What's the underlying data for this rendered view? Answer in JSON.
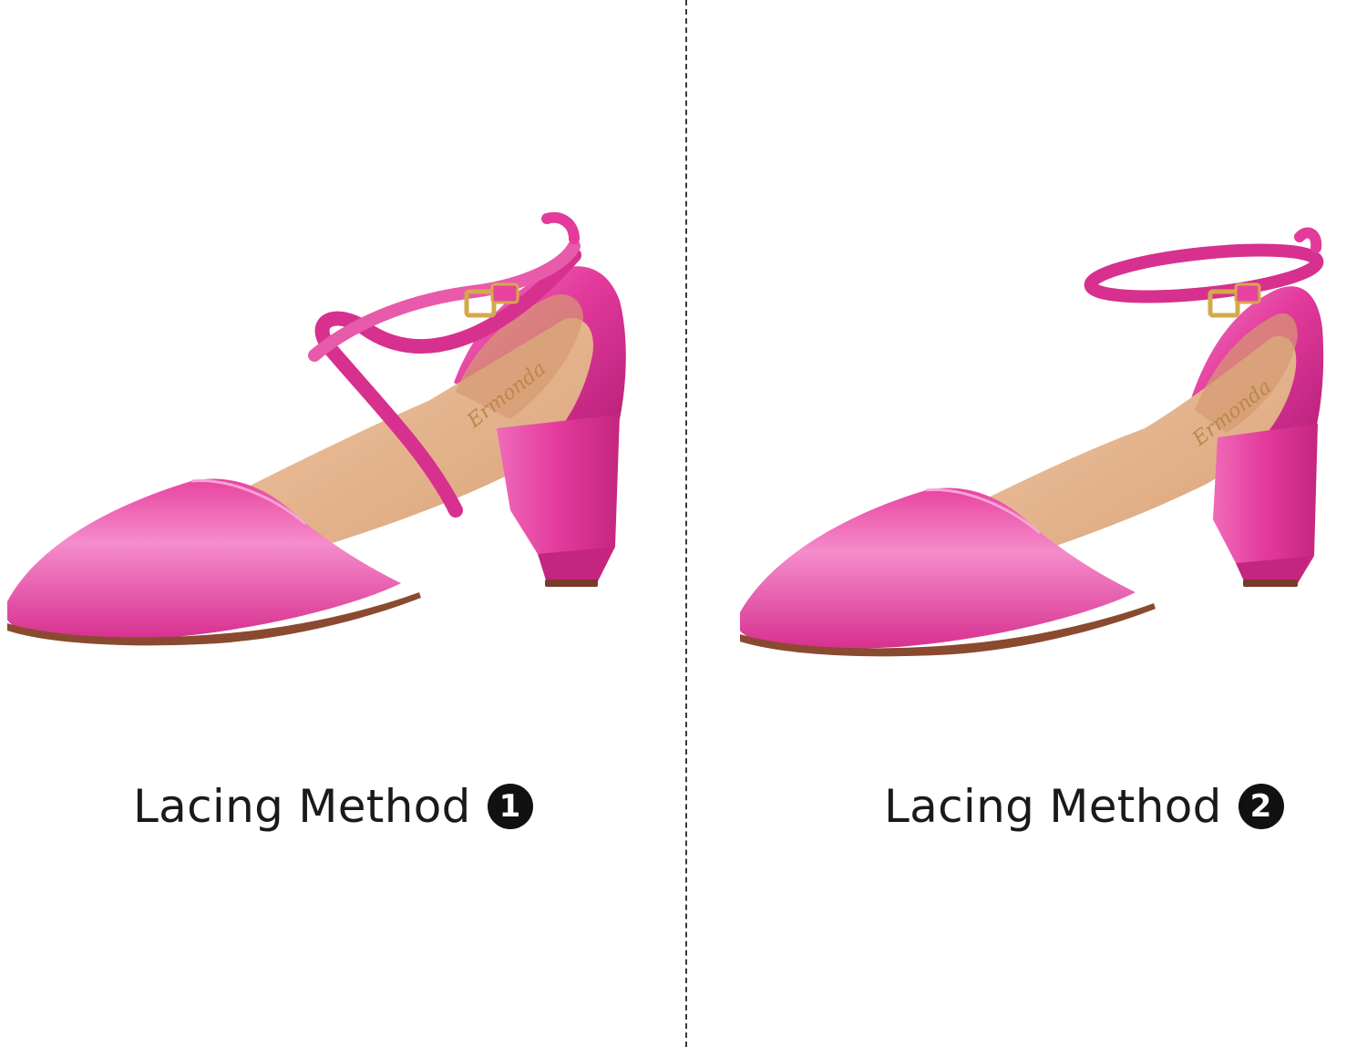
{
  "colors": {
    "satin": "#e33a9c",
    "satin_light": "#f27ac1",
    "satin_dark": "#b8217a",
    "insole": "#e8b690",
    "insole_dark": "#c98c62",
    "buckle": "#d4a94a",
    "badge_bg": "#111111",
    "badge_text": "#ffffff"
  },
  "panels": [
    {
      "caption": "Lacing Method",
      "number": "1",
      "image_label": "pink satin pointed-toe block heel with crisscross ankle strap"
    },
    {
      "caption": "Lacing Method",
      "number": "2",
      "image_label": "pink satin pointed-toe block heel with single ankle strap"
    }
  ],
  "insole_logo_text": "Ermonda"
}
